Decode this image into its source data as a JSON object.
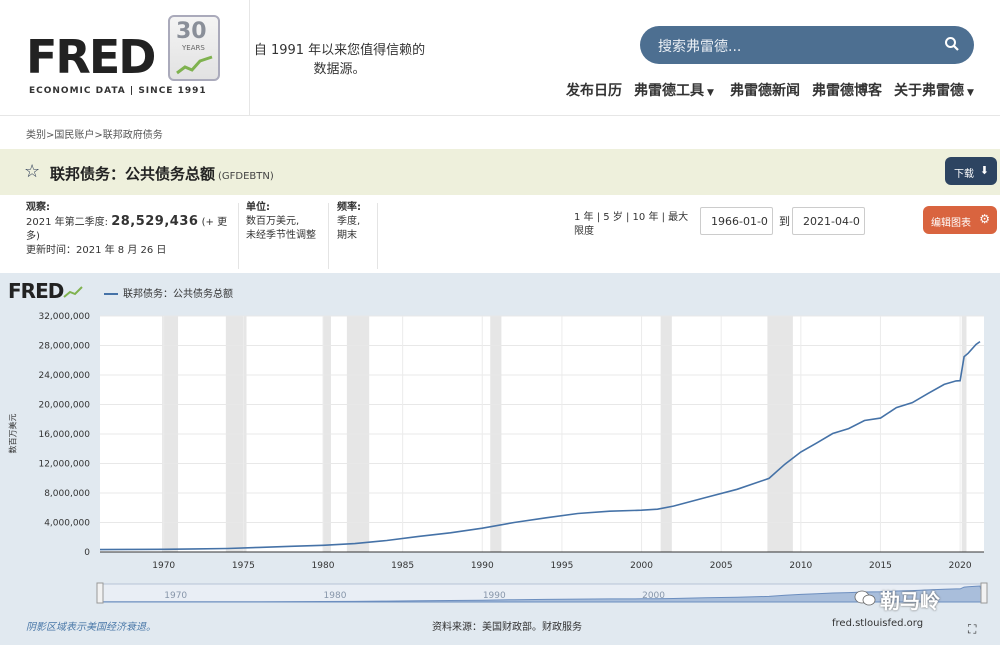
{
  "header": {
    "logo_text": "FRED",
    "logo_badge_number": "30",
    "logo_badge_word": "YEARS",
    "logo_subtitle": "ECONOMIC DATA  |  SINCE 1991",
    "tagline": "自 1991 年以来您值得信赖的数据源。",
    "search_placeholder": "搜索弗雷德...",
    "nav": [
      "发布日历",
      "弗雷德工具",
      "弗雷德新闻",
      "弗雷德博客",
      "关于弗雷德"
    ]
  },
  "breadcrumb": "类别>国民账户>联邦政府债务",
  "series": {
    "title": "联邦债务：公共债务总额",
    "code": "(GFDEBTN)",
    "download_label": "下载",
    "observation_label": "观察:",
    "observation_period": "2021 年第二季度:",
    "observation_value": "28,529,436",
    "observation_more": "(+ 更多)",
    "updated": "更新时间：2021 年 8 月 26 日",
    "units_label": "单位:",
    "units_value_1": "数百万美元,",
    "units_value_2": "未经季节性调整",
    "freq_label": "频率:",
    "freq_value_1": "季度,",
    "freq_value_2": "期末"
  },
  "controls": {
    "ranges": "1 年 | 5 岁 | 10 年 | 最大限度",
    "start_date": "1966-01-0",
    "to_label": "到",
    "end_date": "2021-04-0",
    "edit_label": "编辑图表"
  },
  "chart_meta": {
    "mini_logo": "FRED",
    "legend": "联邦债务：公共债务总额",
    "ylabel": "数百万美元",
    "footnote": "阴影区域表示美国经济衰退。",
    "source": "资料来源：美国财政部。财政服务",
    "site": "fred.stlouisfed.org",
    "watermark": "勒马岭"
  },
  "chart_data": {
    "type": "line",
    "title": "联邦债务：公共债务总额",
    "ylabel": "数百万美元",
    "xlim": [
      1966,
      2021.5
    ],
    "ylim": [
      0,
      32000000
    ],
    "yticks": [
      0,
      4000000,
      8000000,
      12000000,
      16000000,
      20000000,
      24000000,
      28000000,
      32000000
    ],
    "ytick_labels": [
      "0",
      "4,000,000",
      "8,000,000",
      "12,000,000",
      "16,000,000",
      "20,000,000",
      "24,000,000",
      "28,000,000",
      "32,000,000"
    ],
    "xticks": [
      1970,
      1975,
      1980,
      1985,
      1990,
      1995,
      2000,
      2005,
      2010,
      2015,
      2020
    ],
    "nav_ticks": [
      1970,
      1980,
      1990,
      2000
    ],
    "grid": true,
    "recessions": [
      [
        1969.9,
        1970.9
      ],
      [
        1973.9,
        1975.2
      ],
      [
        1980.0,
        1980.5
      ],
      [
        1981.5,
        1982.9
      ],
      [
        1990.5,
        1991.2
      ],
      [
        2001.2,
        2001.9
      ],
      [
        2007.9,
        2009.5
      ],
      [
        2020.1,
        2020.4
      ]
    ],
    "series": [
      {
        "name": "联邦债务：公共债务总额",
        "x": [
          1966,
          1968,
          1970,
          1972,
          1974,
          1976,
          1978,
          1980,
          1982,
          1984,
          1986,
          1988,
          1990,
          1992,
          1994,
          1996,
          1998,
          2000,
          2001,
          2002,
          2004,
          2006,
          2008,
          2009,
          2010,
          2011,
          2012,
          2013,
          2014,
          2015,
          2016,
          2017,
          2018,
          2019,
          2019.75,
          2020.0,
          2020.25,
          2020.5,
          2021.0,
          2021.25
        ],
        "y": [
          320000,
          348000,
          371000,
          427000,
          476000,
          620000,
          771000,
          908000,
          1140000,
          1564000,
          2120000,
          2600000,
          3233000,
          4001000,
          4643000,
          5225000,
          5526000,
          5674000,
          5807000,
          6228000,
          7379000,
          8507000,
          9986000,
          11910000,
          13562000,
          14790000,
          16066000,
          16738000,
          17824000,
          18150000,
          19573000,
          20245000,
          21516000,
          22719000,
          23201000,
          23223000,
          26477000,
          26945000,
          28133000,
          28529436
        ]
      }
    ]
  }
}
